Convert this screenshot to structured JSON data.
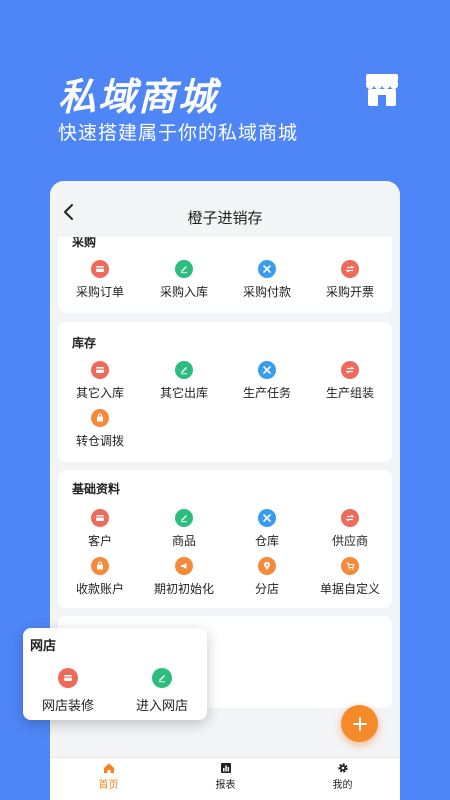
{
  "hero": {
    "title": "私域商城",
    "subtitle": "快速搭建属于你的私域商城",
    "icon": "store-icon"
  },
  "phone": {
    "title": "橙子进销存",
    "back_icon": "back-chevron-icon"
  },
  "sections": {
    "purchase": {
      "title": "采购",
      "items": [
        {
          "label": "采购订单",
          "icon": "card-icon",
          "color": "#ef6a5b"
        },
        {
          "label": "采购入库",
          "icon": "pencil-icon",
          "color": "#2dbd7e"
        },
        {
          "label": "采购付款",
          "icon": "tools-icon",
          "color": "#3a9cf0"
        },
        {
          "label": "采购开票",
          "icon": "swap-icon",
          "color": "#ef6a5b"
        }
      ]
    },
    "inventory": {
      "title": "库存",
      "items": [
        {
          "label": "其它入库",
          "icon": "card-icon",
          "color": "#ef6a5b"
        },
        {
          "label": "其它出库",
          "icon": "pencil-icon",
          "color": "#2dbd7e"
        },
        {
          "label": "生产任务",
          "icon": "tools-icon",
          "color": "#3a9cf0"
        },
        {
          "label": "生产组装",
          "icon": "swap-icon",
          "color": "#ef6a5b"
        },
        {
          "label": "转仓调拨",
          "icon": "bag-icon",
          "color": "#f58a3a"
        }
      ]
    },
    "basics": {
      "title": "基础资料",
      "items": [
        {
          "label": "客户",
          "icon": "card-icon",
          "color": "#ef6a5b"
        },
        {
          "label": "商品",
          "icon": "pencil-icon",
          "color": "#2dbd7e"
        },
        {
          "label": "仓库",
          "icon": "tools-icon",
          "color": "#3a9cf0"
        },
        {
          "label": "供应商",
          "icon": "swap-icon",
          "color": "#ef6a5b"
        },
        {
          "label": "收款账户",
          "icon": "bag-icon",
          "color": "#f58a3a"
        },
        {
          "label": "期初初始化",
          "icon": "megaphone-icon",
          "color": "#f58a3a"
        },
        {
          "label": "分店",
          "icon": "location-icon",
          "color": "#f58a3a"
        },
        {
          "label": "单据自定义",
          "icon": "cart-icon",
          "color": "#f58a3a"
        }
      ]
    }
  },
  "popup": {
    "title": "网店",
    "items": [
      {
        "label": "网店装修",
        "icon": "card-icon",
        "color": "#ef6a5b"
      },
      {
        "label": "进入网店",
        "icon": "pencil-icon",
        "color": "#2dbd7e"
      }
    ]
  },
  "tabbar": {
    "items": [
      {
        "label": "首页",
        "icon": "home-icon",
        "active": true
      },
      {
        "label": "报表",
        "icon": "report-icon",
        "active": false
      },
      {
        "label": "我的",
        "icon": "gear-icon",
        "active": false
      }
    ]
  },
  "fab": {
    "icon": "plus-icon"
  },
  "colors": {
    "background": "#4f86f7",
    "accent": "#f58a2a"
  }
}
